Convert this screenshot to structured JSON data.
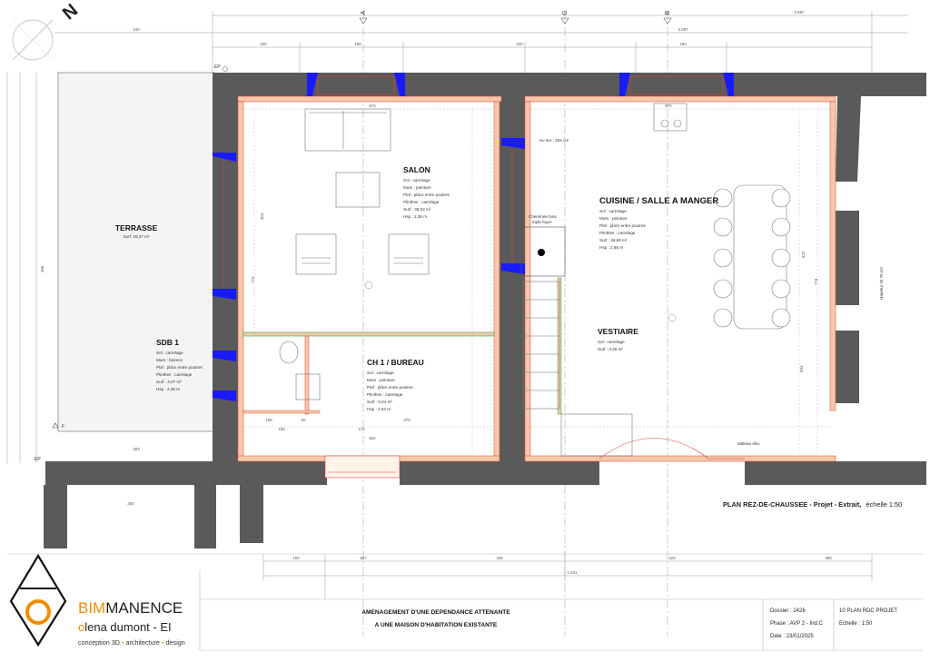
{
  "drawing": {
    "title": "PLAN REZ-DE-CHAUSSEE - Projet - Extrait,",
    "scale": "échelle 1:50",
    "north": "N"
  },
  "grid_markers": [
    "A",
    "G",
    "B"
  ],
  "rooms": [
    {
      "id": "terrasse",
      "name": "TERRASSE",
      "specs": [
        "Surf. 29,37 m²"
      ]
    },
    {
      "id": "salon",
      "name": "SALON",
      "specs": [
        "Sol : carrelage",
        "Murs : peinture",
        "Plaf : plâcs entre poutres",
        "Plinthes : carrelage",
        "Surf : 36,02 m²",
        "Hsp : 2,35 m"
      ]
    },
    {
      "id": "cuisine",
      "name": "CUISINE / SALLE A MANGER",
      "specs": [
        "Sol : carrelage",
        "Murs : peinture",
        "Plaf : plâcs entre poutres",
        "Plinthes : carrelage",
        "Surf : 46,69 m²",
        "Hsp : 2,85 m"
      ]
    },
    {
      "id": "sdb",
      "name": "SDB 1",
      "specs": [
        "Sol : carrelage",
        "Murs : faïence",
        "Plaf : plâcs entre poutres",
        "Plinthes : carrelage",
        "Surf : 4,07 m²",
        "Hsp : 2,35 m"
      ]
    },
    {
      "id": "ch1",
      "name": "CH 1 / BUREAU",
      "specs": [
        "Sol : carrelage",
        "Murs : peinture",
        "Plaf : plâcs entre poutres",
        "Plinthes : carrelage",
        "Surf : 9,04 m²",
        "Hsp : 2,53 m"
      ]
    },
    {
      "id": "vestiaire",
      "name": "VESTIAIRE",
      "specs": [
        "Sol : carrelage",
        "Surf : 3,49 m²"
      ]
    }
  ],
  "annotations": {
    "hv": "Hv sur : 204 cm",
    "chimney": [
      "Cheminée bois",
      "triple foyer"
    ],
    "ep_top": "EP",
    "ep_bottom": "EP",
    "f_mark": "F",
    "level_mark": "Hauteur lst 70 cm",
    "tableau": "tableau élec"
  },
  "dims_top": [
    "240",
    "230",
    "180",
    "240",
    "180",
    "2.097",
    "2.597"
  ],
  "dims_bottom": [
    "192",
    "567",
    "436",
    "224",
    "483",
    "1.941"
  ],
  "dims_inner": [
    "574",
    "674",
    "304",
    "774",
    "522",
    "774",
    "594",
    "502",
    "376",
    "176",
    "155",
    "60",
    "165",
    "383",
    "365",
    "384",
    "90"
  ],
  "project": {
    "line1": "AMENAGEMENT D'UNE DEPENDANCE ATTENANTE",
    "line2": "A UNE MAISON D'HABITATION EXISTANTE"
  },
  "info": {
    "dossier": "Dossier : 2426",
    "phase": "Phase : AVP 2 - Ind.C",
    "date": "Date : 23/01/2025",
    "sheet": "10 PLAN RDC PROJET",
    "echelle": "Echelle : 1:50"
  },
  "brand": {
    "part1": "BIM",
    "part2": "MANENCE",
    "name_first": "o",
    "name_rest": "lena dumont - EI",
    "tagline": [
      "conception 3D",
      "architecture",
      "design"
    ],
    "accent": "#f28c00"
  },
  "colors": {
    "wall": "#5a5a5a",
    "window": "#1a1aff",
    "new_wall": "#f4c9a8",
    "red_line": "#e04040",
    "green_line": "#3aa845"
  }
}
